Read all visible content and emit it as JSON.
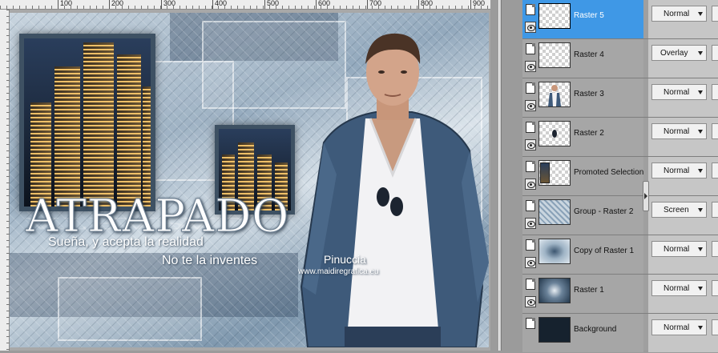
{
  "canvas": {
    "ruler_labels": [
      "100",
      "200",
      "300",
      "400",
      "500",
      "600",
      "700",
      "800",
      "900"
    ],
    "artwork": {
      "title": "ATRAPADO",
      "subtitle_1": "Sueña, y acepta la realidad",
      "subtitle_2": "No te la inventes",
      "credit_name": "Pinuccia",
      "credit_url": "www.maidiregrafica.eu"
    }
  },
  "layers_panel": {
    "layers": [
      {
        "name": "Raster 5",
        "blend": "Normal",
        "selected": true,
        "thumb": "transparent"
      },
      {
        "name": "Raster 4",
        "blend": "Overlay",
        "selected": false,
        "thumb": "transparent"
      },
      {
        "name": "Raster 3",
        "blend": "Normal",
        "selected": false,
        "thumb": "man"
      },
      {
        "name": "Raster 2",
        "blend": "Normal",
        "selected": false,
        "thumb": "small-object"
      },
      {
        "name": "Promoted Selection",
        "blend": "Normal",
        "selected": false,
        "thumb": "city"
      },
      {
        "name": "Group - Raster 2",
        "blend": "Screen",
        "selected": false,
        "thumb": "pattern"
      },
      {
        "name": "Copy of Raster 1",
        "blend": "Normal",
        "selected": false,
        "thumb": "pattern"
      },
      {
        "name": "Raster 1",
        "blend": "Normal",
        "selected": false,
        "thumb": "burst"
      },
      {
        "name": "Background",
        "blend": "Normal",
        "selected": false,
        "thumb": "dark"
      }
    ]
  },
  "colors": {
    "selection": "#3f98e6",
    "panel_bg": "#9f9f9f",
    "background_layer": "#16222e"
  }
}
